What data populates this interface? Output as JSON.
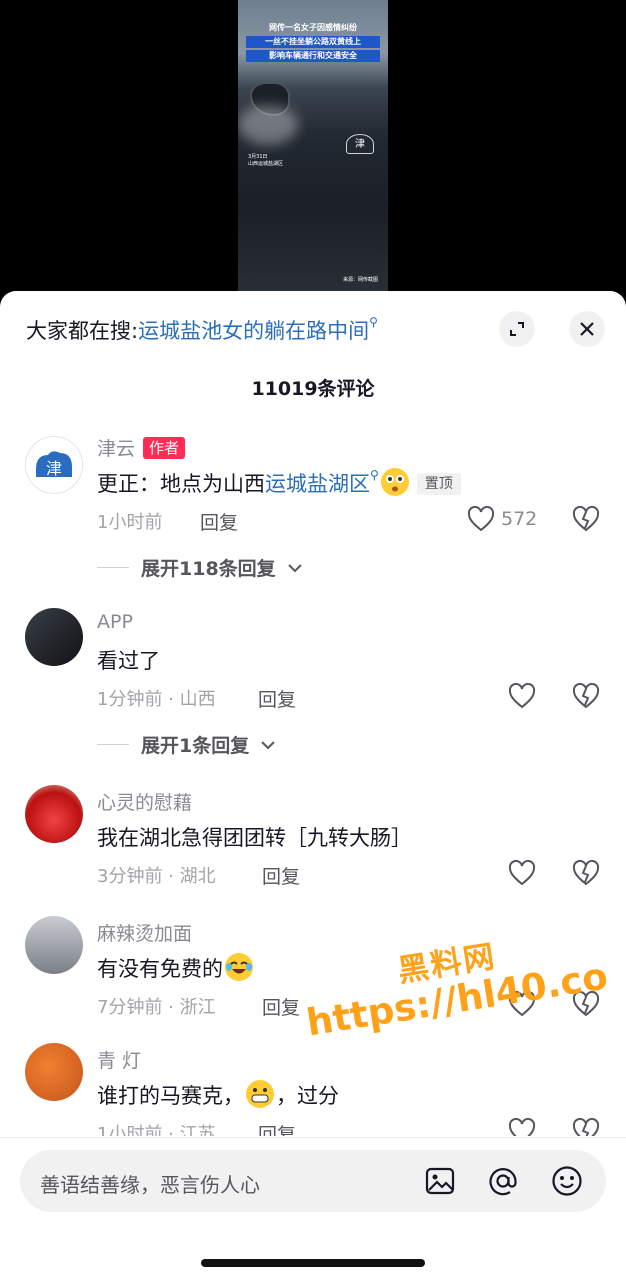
{
  "video": {
    "captions": [
      "网传一名女子因感情纠纷",
      "一丝不挂坐躺公路双黄线上",
      "影响车辆通行和交通安全"
    ],
    "date_line1": "3月31日",
    "date_line2": "山西运城盐湖区",
    "source": "来源：网传截图",
    "logo_glyph": "津"
  },
  "hot_search": {
    "prefix": "大家都在搜:",
    "keyword": "运城盐池女的躺在路中间"
  },
  "comment_count": "11019条评论",
  "comments": [
    {
      "user": "津云",
      "badge": "作者",
      "text_prefix": "更正：地点为山西",
      "text_keyword": "运城盐湖区",
      "pin": "置顶",
      "meta": "1小时前",
      "reply": "回复",
      "likes": "572",
      "avatar_glyph": "津",
      "expand": "展开118条回复"
    },
    {
      "user": "APP",
      "text": "看过了",
      "meta": "1分钟前 · 山西",
      "reply": "回复",
      "expand": "展开1条回复"
    },
    {
      "user": "心灵的慰藉",
      "text": "我在湖北急得团团转［九转大肠］",
      "meta": "3分钟前 · 湖北",
      "reply": "回复"
    },
    {
      "user": "麻辣烫加面",
      "text": "有没有免费的",
      "meta": "7分钟前 · 浙江",
      "reply": "回复"
    },
    {
      "user": "青 灯",
      "text_a": "谁打的马赛克，",
      "text_b": "，过分",
      "meta": "1小时前 · 江苏",
      "reply": "回复"
    }
  ],
  "input": {
    "placeholder": "善语结善缘，恶言伤人心",
    "image_icon": "image-icon",
    "mention_icon": "at-icon",
    "emoji_icon": "emoji-icon"
  },
  "watermark": {
    "line1": "黑料网",
    "line2": "https://hl40.co"
  },
  "colors": {
    "link": "#2b6fba",
    "badge": "#fe2c55",
    "watermark": "#ffa21a"
  }
}
